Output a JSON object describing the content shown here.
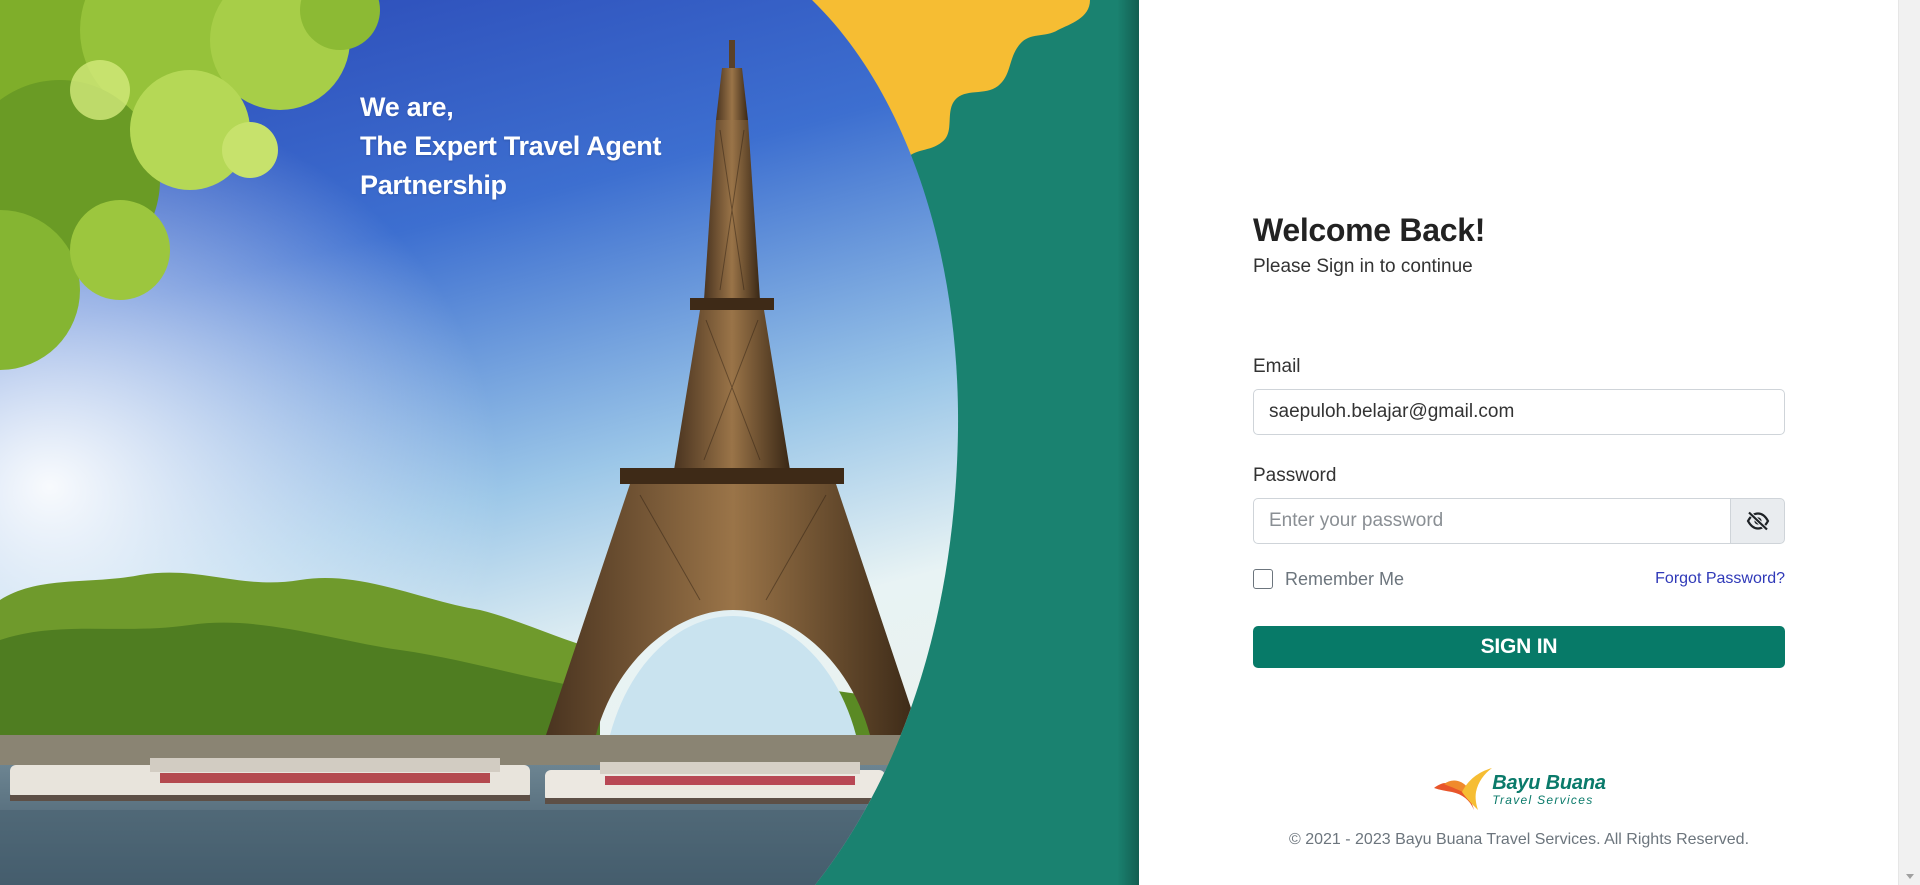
{
  "hero": {
    "tagline_line1": "We are,",
    "tagline_line2": "The Expert Travel Agent",
    "tagline_line3": "Partnership"
  },
  "form": {
    "title": "Welcome Back!",
    "subtitle": "Please Sign in to continue",
    "email_label": "Email",
    "email_value": "saepuloh.belajar@gmail.com",
    "password_label": "Password",
    "password_placeholder": "Enter your password",
    "remember_label": "Remember Me",
    "remember_checked": false,
    "forgot_label": "Forgot Password?",
    "signin_label": "SIGN IN"
  },
  "footer": {
    "logo_name": "Bayu Buana",
    "logo_sub": "Travel Services",
    "copyright": "© 2021 - 2023 Bayu Buana Travel Services. All Rights Reserved."
  },
  "icons": {
    "password_toggle": "eye-slash-icon",
    "logo_mark": "bird-icon"
  },
  "colors": {
    "brand_green": "#077a68",
    "hero_green": "#1a8270",
    "sun_yellow": "#f6bd33",
    "link": "#2f39b8"
  }
}
